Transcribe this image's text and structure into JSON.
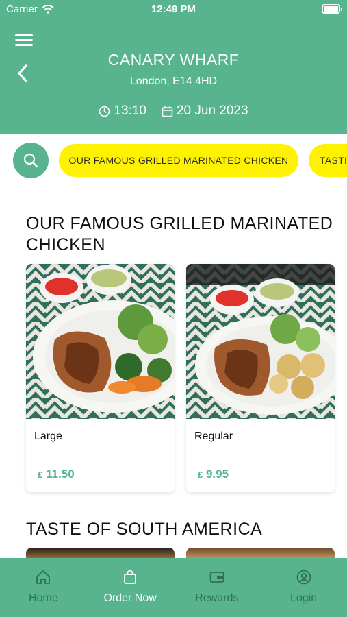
{
  "status_bar": {
    "carrier": "Carrier",
    "time": "12:49 PM"
  },
  "header": {
    "store_name": "CANARY WHARF",
    "address": "London, E14 4HD",
    "time": "13:10",
    "date": "20 Jun 2023",
    "icons": {
      "menu": "hamburger-icon",
      "back": "chevron-left-icon",
      "clock": "clock-icon",
      "calendar": "calendar-icon"
    }
  },
  "categories": {
    "search_icon": "search-icon",
    "items": [
      {
        "label": "OUR FAMOUS GRILLED MARINATED CHICKEN",
        "active": true
      },
      {
        "label": "TASTE OF SOUTH AMERICA",
        "visible_text": "TASTI"
      }
    ]
  },
  "sections": [
    {
      "title": "OUR FAMOUS GRILLED MARINATED CHICKEN",
      "items": [
        {
          "name": "Large",
          "currency": "£",
          "price": "11.50"
        },
        {
          "name": "Regular",
          "currency": "£",
          "price": "9.95"
        }
      ]
    },
    {
      "title": "TASTE OF SOUTH AMERICA"
    }
  ],
  "tabbar": {
    "items": [
      {
        "label": "Home",
        "icon": "home-icon"
      },
      {
        "label": "Order Now",
        "icon": "bag-icon",
        "active": true
      },
      {
        "label": "Rewards",
        "icon": "card-icon"
      },
      {
        "label": "Login",
        "icon": "user-icon"
      }
    ]
  },
  "colors": {
    "primary": "#57b48f",
    "pill": "#fff200",
    "price": "#57b48f"
  }
}
